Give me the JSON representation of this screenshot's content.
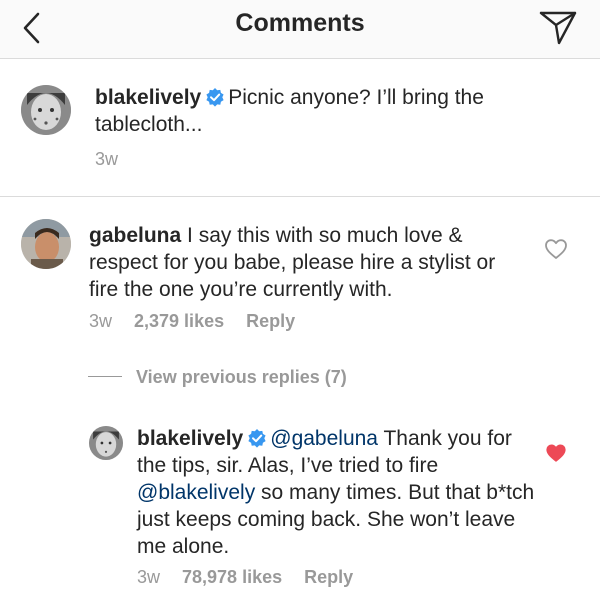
{
  "header": {
    "title": "Comments",
    "back_icon": "chevron-left-icon",
    "share_icon": "paper-plane-icon"
  },
  "caption": {
    "username": "blakelively",
    "text": "Picnic anyone? I’ll bring the tablecloth...",
    "time": "3w"
  },
  "comments": [
    {
      "username": "gabeluna",
      "text": "I say this with so much love & respect for you babe, please hire a stylist or fire the one you’re currently with.",
      "time": "3w",
      "likes": "2,379 likes",
      "reply_label": "Reply",
      "liked": false
    }
  ],
  "view_previous": "View previous replies (7)",
  "replies": [
    {
      "username": "blakelively",
      "mention": "@gabeluna",
      "text_part1": "Thank you for the tips, sir. Alas, I’ve tried to fire",
      "mention2": "@blakelively",
      "text_part2": "so many times. But that b*tch just keeps coming back. She won’t leave me alone.",
      "time": "3w",
      "likes": "78,978 likes",
      "reply_label": "Reply",
      "liked": true
    }
  ],
  "colors": {
    "verified": "#3897f0",
    "heart_liked": "#ed4956",
    "meta_gray": "#999999",
    "mention": "#003569"
  }
}
